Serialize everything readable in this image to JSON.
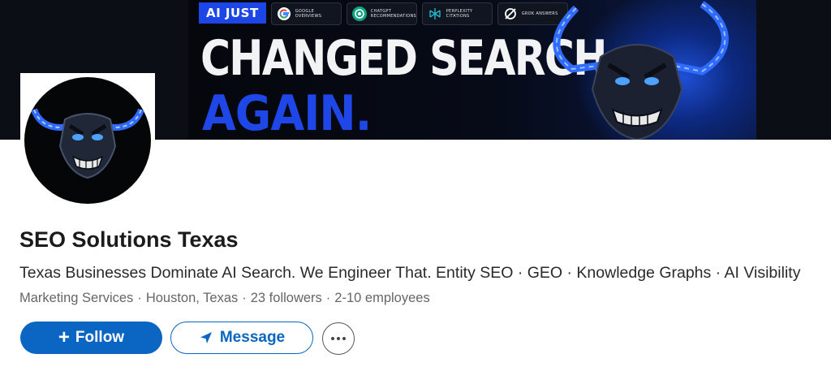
{
  "banner": {
    "badge": "AI JUST",
    "chips": [
      {
        "icon": "google-icon",
        "text": "GOOGLE OVERVIEWS",
        "color": "#ffffff"
      },
      {
        "icon": "chatgpt-icon",
        "text": "CHATGPT RECOMMENDATIONS",
        "color": "#10a37f"
      },
      {
        "icon": "perplexity-icon",
        "text": "PERPLEXITY CITATIONS",
        "color": "#20b8cd"
      },
      {
        "icon": "grok-icon",
        "text": "GROK ANSWERS",
        "color": "#ffffff"
      }
    ],
    "headline_line1": "CHANGED SEARCH",
    "headline_line2": "AGAIN."
  },
  "company": {
    "name": "SEO Solutions Texas",
    "tagline": "Texas Businesses Dominate AI Search. We Engineer That. Entity SEO · GEO · Knowledge Graphs · AI Visibility",
    "industry": "Marketing Services",
    "location": "Houston, Texas",
    "followers": "23 followers",
    "employees": "2-10 employees"
  },
  "actions": {
    "follow_label": "Follow",
    "message_label": "Message"
  },
  "colors": {
    "brand_blue": "#0a66c2",
    "banner_blue": "#1f47e8"
  }
}
